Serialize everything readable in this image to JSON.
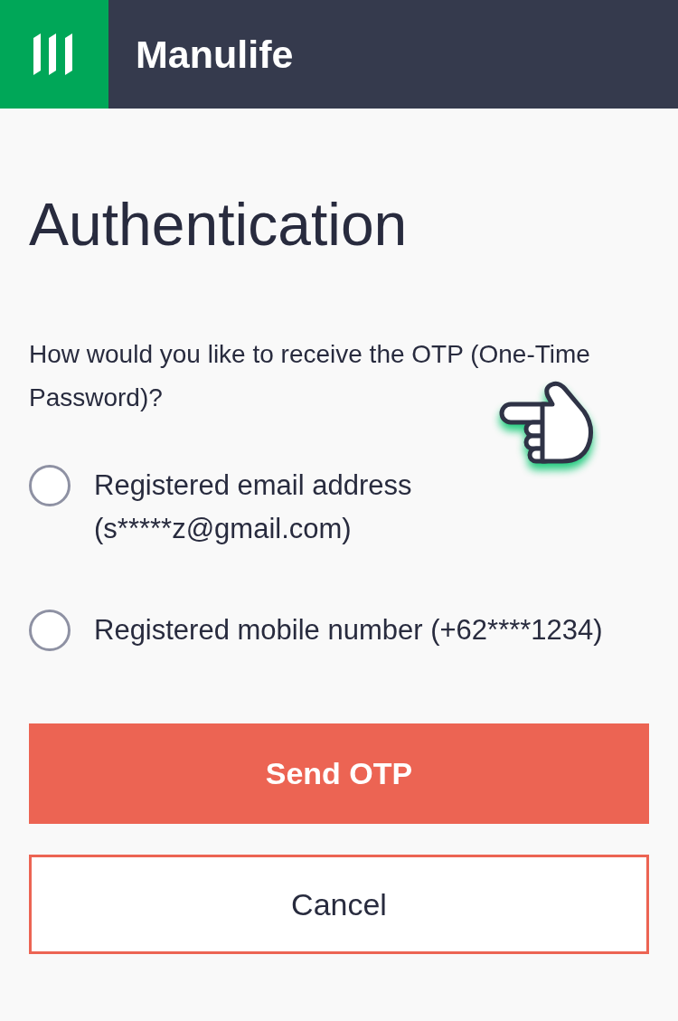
{
  "header": {
    "logo_text": "Manulife"
  },
  "title": "Authentication",
  "prompt": "How would you like to receive the OTP (One-Time Password)?",
  "options": [
    {
      "label": "Registered email address (s*****z@gmail.com)",
      "selected": false
    },
    {
      "label": "Registered mobile number (+62****1234)",
      "selected": false
    }
  ],
  "buttons": [
    {
      "label": "Send OTP",
      "kind": "primary"
    },
    {
      "label": "Cancel",
      "kind": "secondary"
    }
  ]
}
